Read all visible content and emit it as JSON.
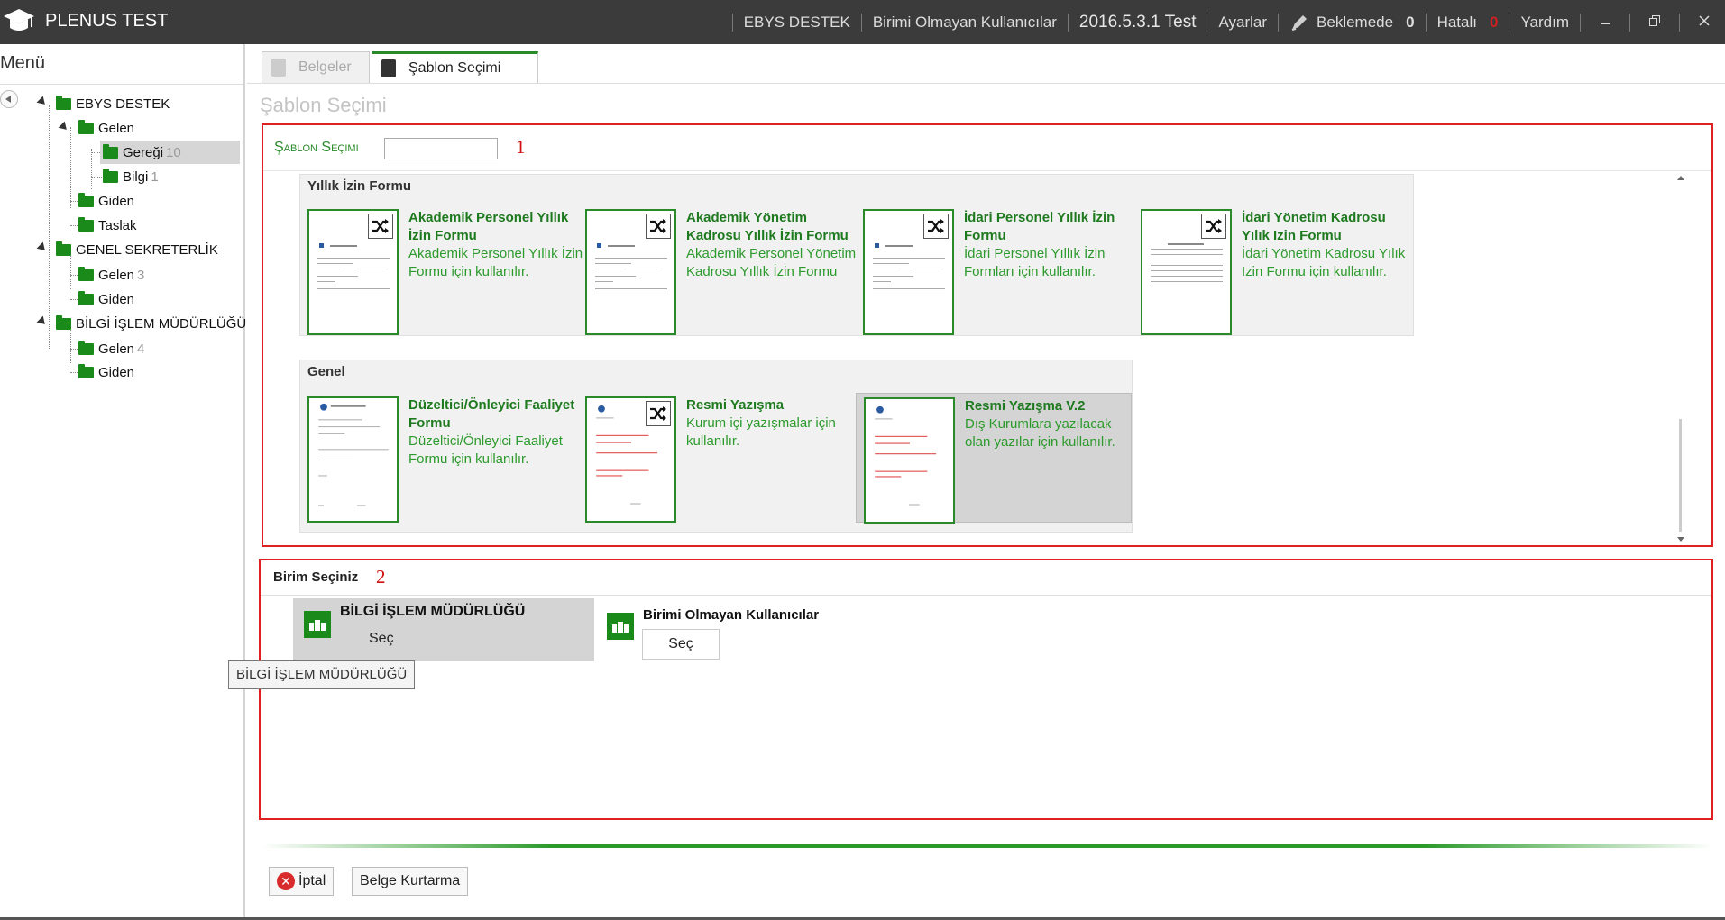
{
  "app": {
    "title": "PLENUS TEST"
  },
  "topnav": {
    "user_unit": "EBYS DESTEK",
    "unitless_users": "Birimi Olmayan Kullanıcılar",
    "version": "2016.5.3.1 Test",
    "settings": "Ayarlar",
    "pending_label": "Beklemede",
    "pending_count": "0",
    "error_label": "Hatalı",
    "error_count": "0",
    "help": "Yardım"
  },
  "sidebar": {
    "title": "Menü",
    "tree": [
      {
        "label": "EBYS DESTEK",
        "count": ""
      },
      {
        "label": "Gelen",
        "count": ""
      },
      {
        "label": "Gereği",
        "count": "10"
      },
      {
        "label": "Bilgi",
        "count": "1"
      },
      {
        "label": "Giden",
        "count": ""
      },
      {
        "label": "Taslak",
        "count": ""
      },
      {
        "label": "GENEL SEKRETERLİK",
        "count": ""
      },
      {
        "label": "Gelen",
        "count": "3"
      },
      {
        "label": "Giden",
        "count": ""
      },
      {
        "label": "BİLGİ İŞLEM MÜDÜRLÜĞÜ",
        "count": ""
      },
      {
        "label": "Gelen",
        "count": "4"
      },
      {
        "label": "Giden",
        "count": ""
      }
    ]
  },
  "tabs": [
    {
      "label": "Belgeler"
    },
    {
      "label": "Şablon Seçimi"
    }
  ],
  "page_title": "Şablon Seçimi",
  "sablon": {
    "label": "Şablon Seçimi",
    "search_value": "",
    "marker": "1",
    "groups": [
      {
        "title": "Yıllık İzin Formu",
        "cards": [
          {
            "title": "Akademik Personel Yıllık İzin Formu",
            "desc": "Akademik Personel Yıllık İzin Formu için kullanılır."
          },
          {
            "title": "Akademik Yönetim Kadrosu Yıllık İzin Formu",
            "desc": "Akademik Personel Yönetim Kadrosu Yıllık İzin Formu"
          },
          {
            "title": "İdari Personel Yıllık İzin Formu",
            "desc": "İdari Personel Yıllık İzin Formları için kullanılır."
          },
          {
            "title": "İdari Yönetim Kadrosu Yılık Izin Formu",
            "desc": "İdari Yönetim Kadrosu Yılık Izin Formu için kullanılır."
          }
        ]
      },
      {
        "title": "Genel",
        "cards": [
          {
            "title": "Düzeltici/Önleyici Faaliyet Formu",
            "desc": "Düzeltici/Önleyici Faaliyet Formu için kullanılır."
          },
          {
            "title": "Resmi Yazışma",
            "desc": "Kurum içi yazışmalar için kullanılır."
          },
          {
            "title": "Resmi Yazışma V.2",
            "desc": "Dış Kurumlara yazılacak olan yazılar için kullanılır."
          }
        ]
      }
    ]
  },
  "birim": {
    "label": "Birim Seçiniz",
    "marker": "2",
    "units": [
      {
        "name": "BİLGİ İŞLEM MÜDÜRLÜĞÜ",
        "action": "Seç"
      },
      {
        "name": "Birimi Olmayan Kullanıcılar",
        "action": "Seç"
      }
    ]
  },
  "tooltip": "BİLGİ İŞLEM MÜDÜRLÜĞÜ",
  "footer": {
    "cancel": "İptal",
    "recover": "Belge Kurtarma"
  },
  "colors": {
    "brand_green": "#2a8a2a",
    "topbar": "#3b3b3b",
    "annotation_red": "#e02020"
  }
}
